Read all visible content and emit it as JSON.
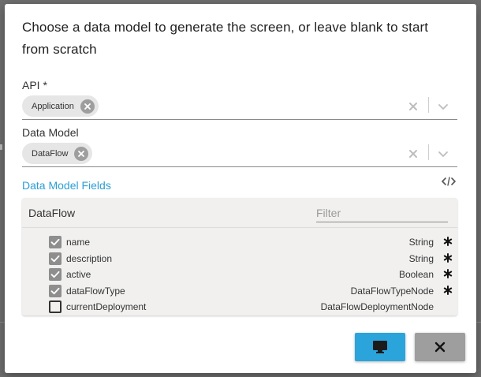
{
  "dialog": {
    "title": "Choose a data model to generate the screen, or leave blank to start from scratch"
  },
  "api": {
    "label": "API *",
    "chip": "Application"
  },
  "data_model": {
    "label": "Data Model",
    "chip": "DataFlow"
  },
  "fields_section": {
    "title": "Data Model Fields",
    "model_name": "DataFlow",
    "filter_placeholder": "Filter",
    "fields": [
      {
        "name": "name",
        "type": "String",
        "checked": true,
        "required": true
      },
      {
        "name": "description",
        "type": "String",
        "checked": true,
        "required": true
      },
      {
        "name": "active",
        "type": "Boolean",
        "checked": true,
        "required": true
      },
      {
        "name": "dataFlowType",
        "type": "DataFlowTypeNode",
        "checked": true,
        "required": true
      },
      {
        "name": "currentDeployment",
        "type": "DataFlowDeploymentNode",
        "checked": false,
        "required": false
      }
    ]
  },
  "icons": {
    "chip_remove": "close-circle-icon",
    "clear": "close-icon",
    "dropdown": "chevron-down-icon",
    "code": "code-icon",
    "check": "check-icon",
    "required": "asterisk-icon",
    "generate": "monitor-icon",
    "cancel": "close-icon"
  },
  "colors": {
    "accent": "#2ba4dc",
    "section_title": "#2b9fd4",
    "cancel_button": "#9e9e9e",
    "chip_bg": "#e6e6e6",
    "panel_bg": "#f1f0ef"
  }
}
